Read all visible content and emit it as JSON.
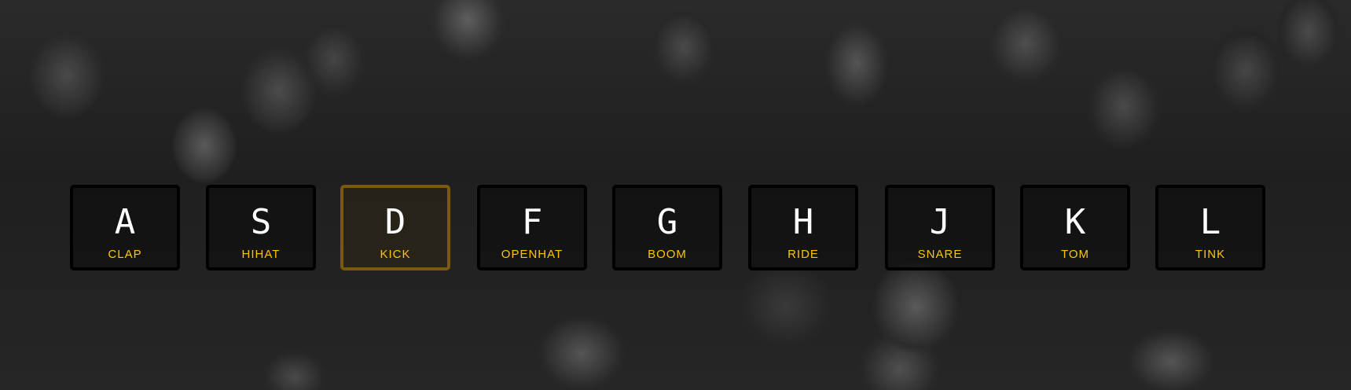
{
  "colors": {
    "accent": "#ffc600",
    "key_border": "#000000",
    "active_border": "#7a5a0a"
  },
  "keys": [
    {
      "letter": "A",
      "sound": "CLAP"
    },
    {
      "letter": "S",
      "sound": "HIHAT"
    },
    {
      "letter": "D",
      "sound": "KICK",
      "active": true
    },
    {
      "letter": "F",
      "sound": "OPENHAT"
    },
    {
      "letter": "G",
      "sound": "BOOM"
    },
    {
      "letter": "H",
      "sound": "RIDE"
    },
    {
      "letter": "J",
      "sound": "SNARE"
    },
    {
      "letter": "K",
      "sound": "TOM"
    },
    {
      "letter": "L",
      "sound": "TINK"
    }
  ]
}
